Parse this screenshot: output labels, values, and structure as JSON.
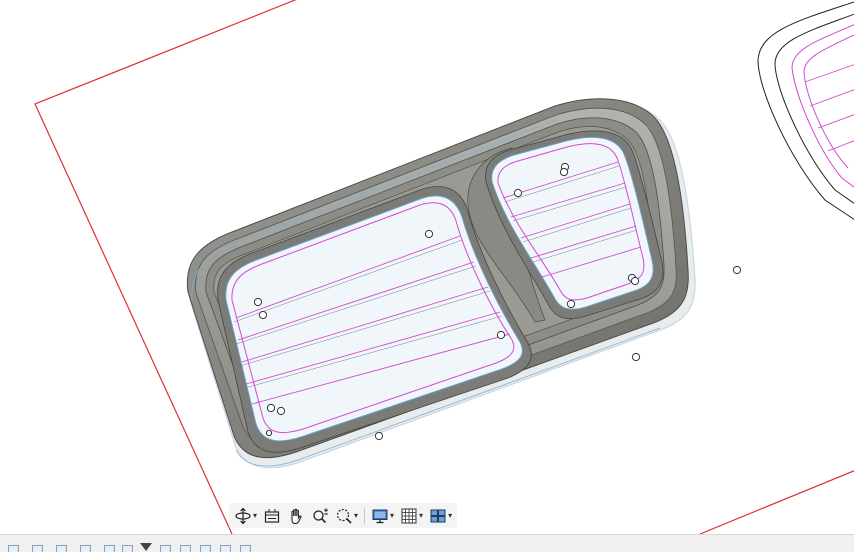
{
  "viewport": {
    "label": "",
    "sketch_color": "#e03030",
    "toolpath_color": "#d24ad2",
    "body_color": "#8f8f8a",
    "cavity_color": "#f1f6fb"
  },
  "toolbar": {
    "buttons": [
      {
        "name": "orbit",
        "icon": "orbit-icon",
        "has_menu": true
      },
      {
        "name": "look-at",
        "icon": "look-at-icon",
        "has_menu": false
      },
      {
        "name": "pan",
        "icon": "hand-icon",
        "has_menu": false
      },
      {
        "name": "zoom",
        "icon": "zoom-icon",
        "has_menu": false
      },
      {
        "name": "fit",
        "icon": "zoom-window-icon",
        "has_menu": true
      },
      {
        "name": "display-settings",
        "icon": "monitor-icon",
        "has_menu": true
      },
      {
        "name": "grid-snaps",
        "icon": "grid-icon",
        "has_menu": true
      },
      {
        "name": "viewports",
        "icon": "viewports-icon",
        "has_menu": true
      }
    ]
  },
  "timeline": {
    "label": ""
  }
}
